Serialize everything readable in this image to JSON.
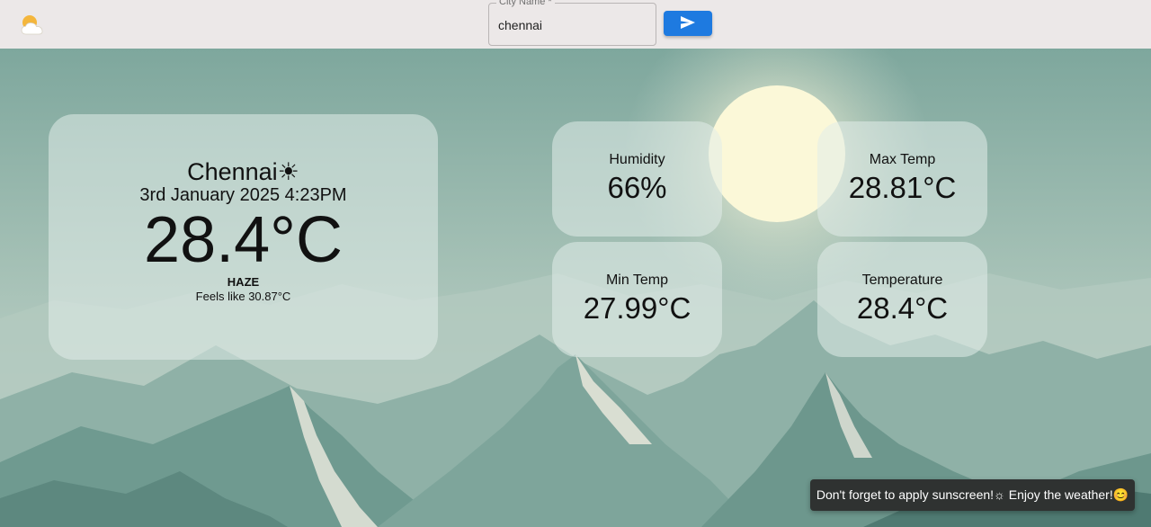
{
  "header": {
    "logo_icon": "partly-cloudy-icon",
    "city_field": {
      "label": "City Name *",
      "value": "chennai"
    },
    "send_icon": "send-icon"
  },
  "weather": {
    "city": "Chennai",
    "city_icon": "☀",
    "date_time": "3rd January 2025 4:23PM",
    "temperature": "28.4°C",
    "condition": "HAZE",
    "feels_like": "Feels like 30.87°C"
  },
  "stats": {
    "humidity": {
      "label": "Humidity",
      "value": "66%"
    },
    "max_temp": {
      "label": "Max Temp",
      "value": "28.81°C"
    },
    "min_temp": {
      "label": "Min Temp",
      "value": "27.99°C"
    },
    "temperature": {
      "label": "Temperature",
      "value": "28.4°C"
    }
  },
  "toast": {
    "message": "Don't forget to apply sunscreen!☼ Enjoy the weather!😊"
  },
  "colors": {
    "header_bg": "#ece8e8",
    "accent": "#1e7ae0",
    "toast_bg": "#2f3231",
    "sky": "#86aaa0"
  }
}
